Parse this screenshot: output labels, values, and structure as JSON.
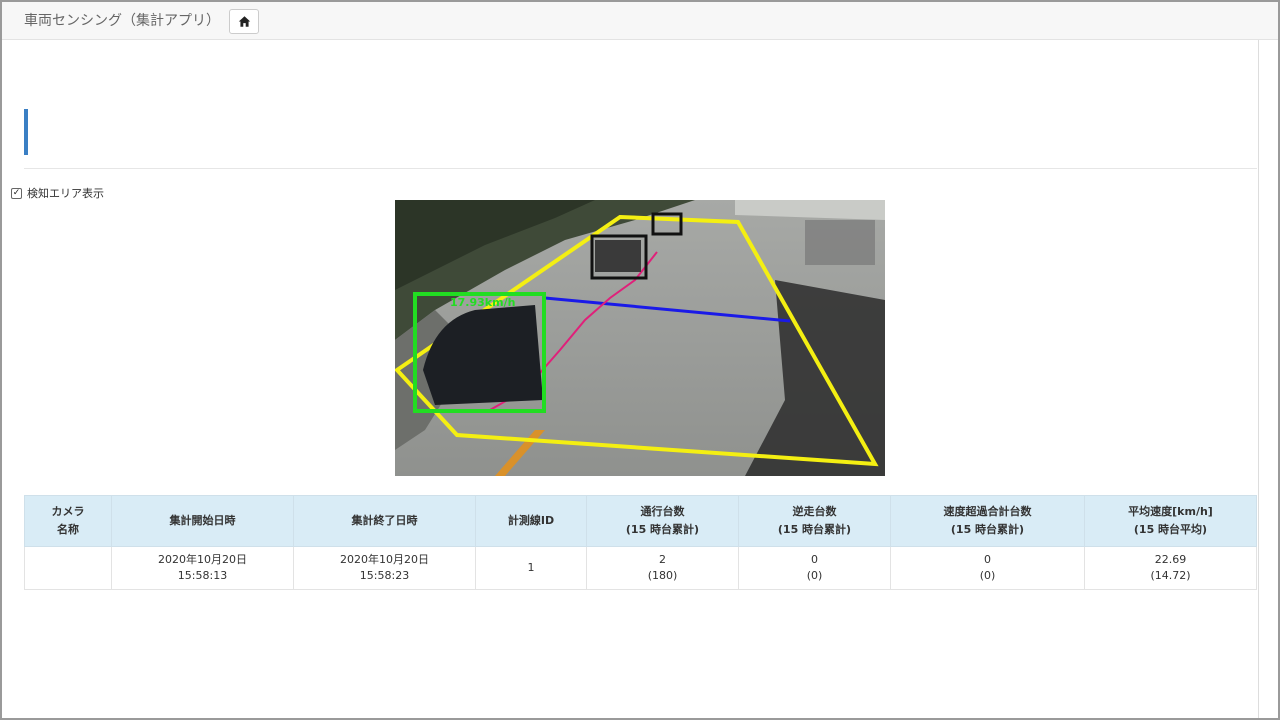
{
  "app": {
    "title": "車両センシング（集計アプリ）",
    "home_icon": "home-icon"
  },
  "filter": {
    "show_detection_area_label": "検知エリア表示",
    "show_detection_area_checked": true
  },
  "camera": {
    "speed_label": "17.93km/h",
    "colors": {
      "detection_area": "#f4ef12",
      "tracked_vehicle": "#22dd22",
      "other_vehicle": "#111111",
      "count_line": "#1a1ae8",
      "trajectory": "#e0207a"
    }
  },
  "table": {
    "headers": [
      {
        "line1": "カメラ",
        "line2": "名称"
      },
      {
        "line1": "集計開始日時",
        "line2": ""
      },
      {
        "line1": "集計終了日時",
        "line2": ""
      },
      {
        "line1": "計測線ID",
        "line2": ""
      },
      {
        "line1": "通行台数",
        "line2": "(15 時台累計)"
      },
      {
        "line1": "逆走台数",
        "line2": "(15 時台累計)"
      },
      {
        "line1": "速度超過合計台数",
        "line2": "(15 時台累計)"
      },
      {
        "line1": "平均速度[km/h]",
        "line2": "(15 時台平均)"
      }
    ],
    "rows": [
      [
        {
          "line1": "",
          "line2": ""
        },
        {
          "line1": "2020年10月20日",
          "line2": "15:58:13"
        },
        {
          "line1": "2020年10月20日",
          "line2": "15:58:23"
        },
        {
          "line1": "1",
          "line2": ""
        },
        {
          "line1": "2",
          "line2": "(180)"
        },
        {
          "line1": "0",
          "line2": "(0)"
        },
        {
          "line1": "0",
          "line2": "(0)"
        },
        {
          "line1": "22.69",
          "line2": "(14.72)"
        }
      ]
    ]
  }
}
